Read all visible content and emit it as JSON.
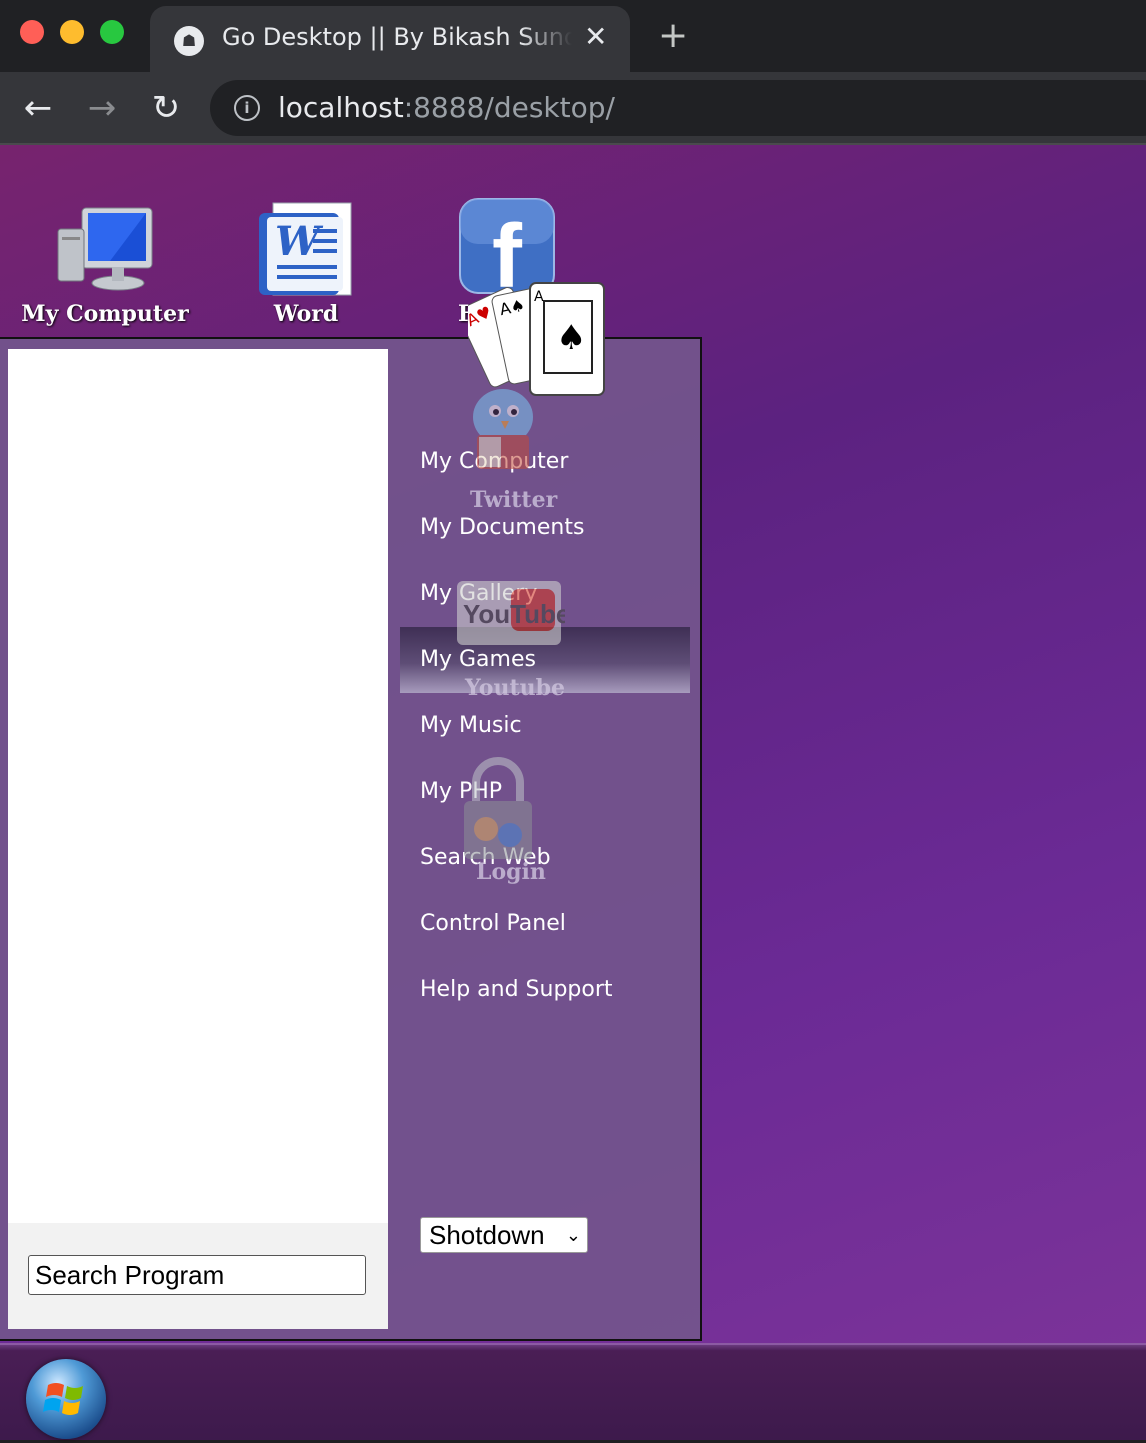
{
  "browser": {
    "tab_title": "Go Desktop || By Bikash Sundar",
    "url_host": "localhost",
    "url_rest": ":8888/desktop/"
  },
  "desktop_icons": [
    {
      "label": "My Computer",
      "icon": "monitor-icon"
    },
    {
      "label": "Word",
      "icon": "word-icon"
    },
    {
      "label": "Fa",
      "icon": "facebook-icon"
    }
  ],
  "ghost_icons": {
    "twitter": "Twitter",
    "youtube_logo": "YouTube",
    "youtube": "Youtube",
    "login": "Login"
  },
  "start_menu": {
    "search_placeholder": "Search Program",
    "items": [
      {
        "label": "My Computer"
      },
      {
        "label": "My Documents"
      },
      {
        "label": "My Gallery"
      },
      {
        "label": "My Games",
        "active": true
      },
      {
        "label": "My Music"
      },
      {
        "label": "My PHP"
      },
      {
        "label": "Search Web"
      },
      {
        "label": "Control Panel"
      },
      {
        "label": "Help and Support"
      }
    ],
    "shutdown_selected": "Shotdown"
  },
  "colors": {
    "desktop_gradient_start": "#77236e",
    "desktop_gradient_end": "#7b3399",
    "menu_panel": "#73548c",
    "taskbar": "#3d1a4c"
  }
}
